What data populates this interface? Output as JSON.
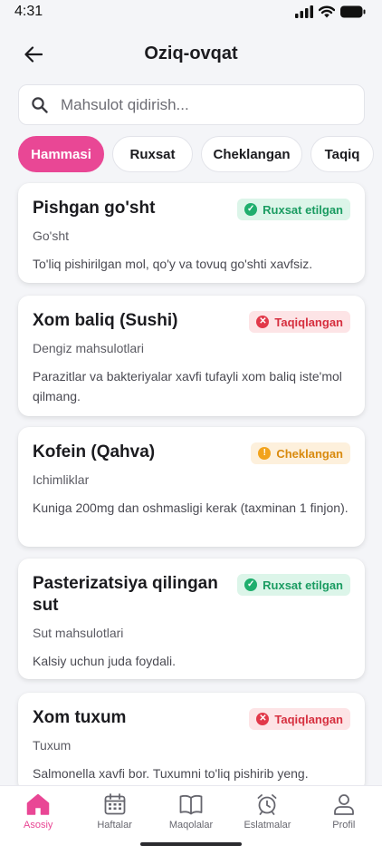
{
  "status_bar": {
    "time": "4:31"
  },
  "header": {
    "title": "Oziq-ovqat"
  },
  "search": {
    "placeholder": "Mahsulot qidirish..."
  },
  "filters": [
    {
      "label": "Hammasi",
      "active": true
    },
    {
      "label": "Ruxsat",
      "active": false
    },
    {
      "label": "Cheklangan",
      "active": false
    },
    {
      "label": "Taqiq",
      "active": false
    }
  ],
  "foods": [
    {
      "title": "Pishgan go'sht",
      "category": "Go'sht",
      "description": "To'liq pishirilgan mol, qo'y va tovuq go'shti xavfsiz.",
      "status": "allowed",
      "status_label": "Ruxsat etilgan"
    },
    {
      "title": "Xom baliq (Sushi)",
      "category": "Dengiz mahsulotlari",
      "description": "Parazitlar va bakteriyalar xavfi tufayli xom baliq iste'mol qilmang.",
      "status": "banned",
      "status_label": "Taqiqlangan"
    },
    {
      "title": "Kofein (Qahva)",
      "category": "Ichimliklar",
      "description": "Kuniga 200mg dan oshmasligi kerak (taxminan 1 finjon).",
      "status": "limited",
      "status_label": "Cheklangan"
    },
    {
      "title": "Pasterizatsiya qilingan sut",
      "category": "Sut mahsulotlari",
      "description": "Kalsiy uchun juda foydali.",
      "status": "allowed",
      "status_label": "Ruxsat etilgan"
    },
    {
      "title": "Xom tuxum",
      "category": "Tuxum",
      "description": "Salmonella xavfi bor. Tuxumni to'liq pishirib yeng.",
      "status": "banned",
      "status_label": "Taqiqlangan"
    }
  ],
  "bottom_nav": [
    {
      "label": "Asosiy",
      "icon": "home-icon",
      "active": true
    },
    {
      "label": "Haftalar",
      "icon": "calendar-icon",
      "active": false
    },
    {
      "label": "Maqolalar",
      "icon": "book-icon",
      "active": false
    },
    {
      "label": "Eslatmalar",
      "icon": "alarm-clock-icon",
      "active": false
    },
    {
      "label": "Profil",
      "icon": "profile-icon",
      "active": false
    }
  ],
  "colors": {
    "accent": "#e94795",
    "allowed": "#1fae6d",
    "banned": "#e2394a",
    "limited": "#f2a31d"
  }
}
